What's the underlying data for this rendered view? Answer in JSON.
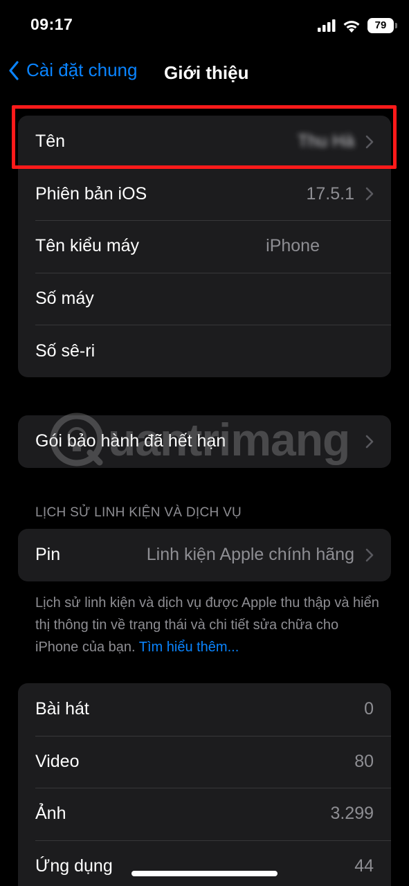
{
  "status": {
    "time": "09:17",
    "battery": "79"
  },
  "nav": {
    "back_label": "Cài đặt chung",
    "title": "Giới thiệu"
  },
  "about": {
    "name_label": "Tên",
    "name_value": "Thu Hà",
    "ios_label": "Phiên bản iOS",
    "ios_value": "17.5.1",
    "model_label": "Tên kiểu máy",
    "model_value": "iPhone",
    "number_label": "Số máy",
    "serial_label": "Số sê-ri"
  },
  "warranty": {
    "label": "Gói bảo hành đã hết hạn"
  },
  "parts_section": {
    "header": "LỊCH SỬ LINH KIỆN VÀ DỊCH VỤ",
    "battery_label": "Pin",
    "battery_value": "Linh kiện Apple chính hãng",
    "note": "Lịch sử linh kiện và dịch vụ được Apple thu thập và hiển thị thông tin về trạng thái và chi tiết sửa chữa cho iPhone của bạn.",
    "learn_more": "Tìm hiểu thêm..."
  },
  "media": {
    "songs_label": "Bài hát",
    "songs_value": "0",
    "videos_label": "Video",
    "videos_value": "80",
    "photos_label": "Ảnh",
    "photos_value": "3.299",
    "apps_label": "Ứng dụng",
    "apps_value": "44"
  },
  "watermark": {
    "text": "uantrimang"
  },
  "colors": {
    "accent": "#0a84ff",
    "highlight": "#ff1a1a",
    "cell": "#1c1c1e",
    "secondary": "#8e8e93"
  }
}
